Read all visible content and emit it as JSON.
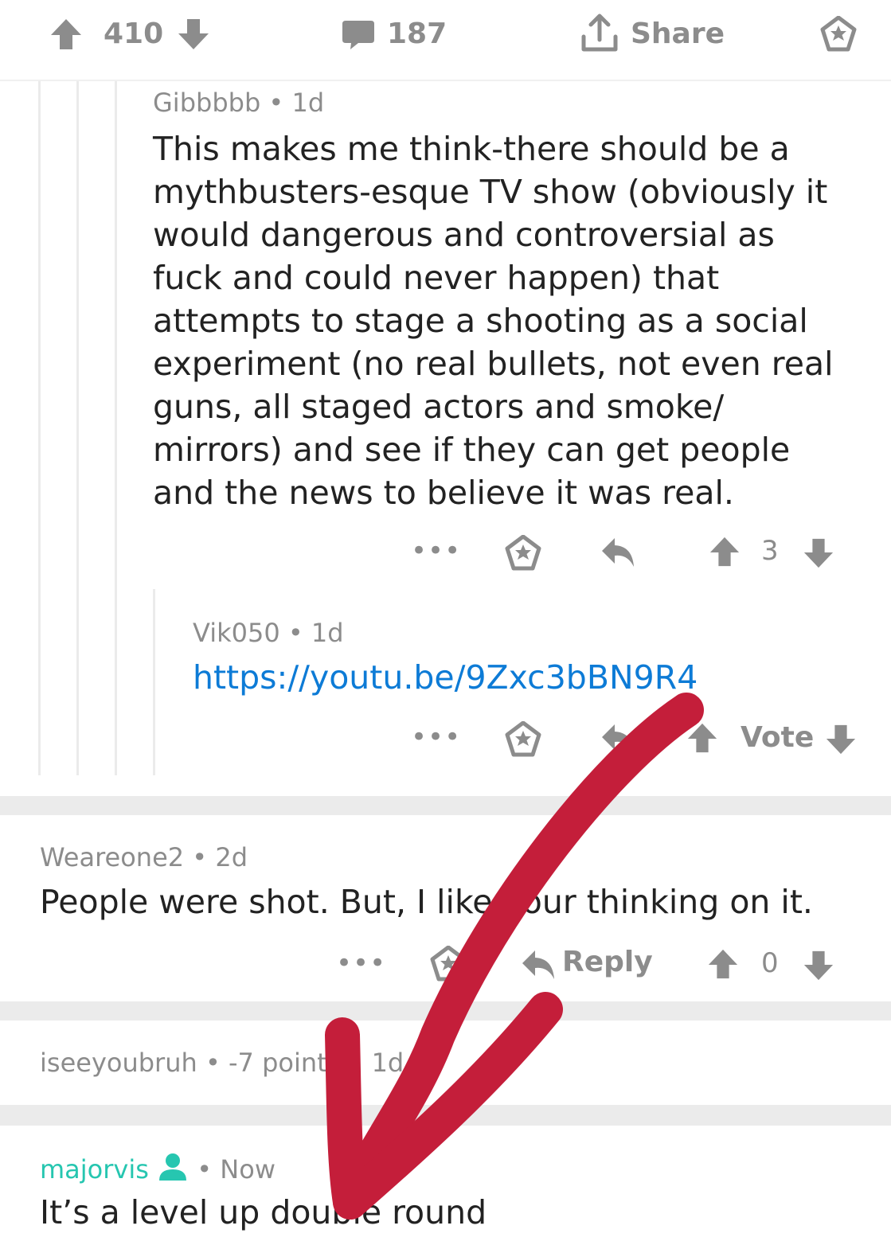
{
  "post_bar": {
    "upvotes": "410",
    "comments": "187",
    "share_label": "Share"
  },
  "comments": [
    {
      "author": "Gibbbbb",
      "age": "1d",
      "lines": [
        "This makes me think-there should be a",
        "mythbusters-esque TV show (obviously it",
        "would dangerous and controversial as",
        "fuck and could never happen) that",
        "attempts to stage a shooting as a social",
        "experiment (no real bullets, not even real",
        "guns, all staged actors and smoke/",
        "mirrors) and see if they can get people",
        "and the news to believe it was real."
      ],
      "more": "•••",
      "score": "3"
    },
    {
      "author": "Vik050",
      "age": "1d",
      "link": "https://youtu.be/9Zxc3bBN9R4",
      "more": "•••",
      "vote_label": "Vote"
    },
    {
      "author": "Weareone2",
      "age": "2d",
      "text": "People were shot. But, I like your thinking on it.",
      "more": "•••",
      "reply_label": "Reply",
      "score": "0"
    },
    {
      "author": "iseeyoubruh",
      "collapsed_meta": "-7 points • 1d"
    },
    {
      "author": "majorvis",
      "age": "Now",
      "text": "It’s a level up double round"
    }
  ],
  "separator": "•",
  "colors": {
    "accent_teal": "#26c6b0",
    "link_blue": "#0d7bd6",
    "arrow_red": "#c41e3a",
    "muted_grey": "#8c8c8c"
  }
}
